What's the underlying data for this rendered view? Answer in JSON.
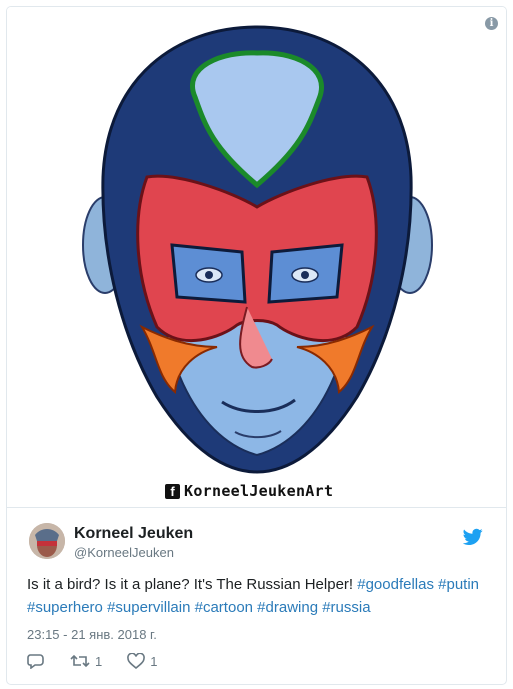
{
  "image": {
    "alt": "Illustration of a face with a red superhero mask",
    "watermark": "KorneelJeukenArt",
    "watermark_icon": "facebook-icon"
  },
  "tweet": {
    "author_name": "Korneel Jeuken",
    "author_handle": "@KorneelJeuken",
    "text_plain": "Is it a bird? Is it a plane? It's The Russian Helper! ",
    "hashtags": [
      "#goodfellas",
      "#putin",
      "#superhero",
      "#supervillain",
      "#cartoon",
      "#drawing",
      "#russia"
    ],
    "timestamp": "23:15 - 21 янв. 2018 г.",
    "retweet_count": "1",
    "like_count": "1"
  },
  "icons": {
    "info": "info-icon",
    "twitter": "twitter-bird-icon",
    "reply": "reply-icon",
    "retweet": "retweet-icon",
    "like": "heart-icon"
  },
  "colors": {
    "hashtag": "#2b7bb9",
    "secondary_text": "#697882",
    "twitter_blue": "#1da1f2",
    "border": "#e1e8ed"
  }
}
